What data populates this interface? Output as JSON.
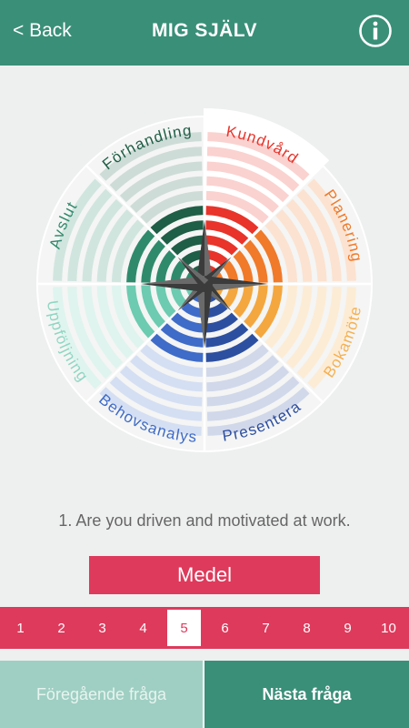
{
  "header": {
    "back_label": "< Back",
    "title": "MIG SJÄLV",
    "info_icon": "info-icon"
  },
  "wheel": {
    "segments": [
      {
        "label": "Kundvård",
        "color": "#e8342a",
        "label_color": "#e8342a",
        "level": 5,
        "highlighted": true
      },
      {
        "label": "Planering",
        "color": "#f07a2a",
        "label_color": "#f07a2a",
        "level": 5,
        "highlighted": false
      },
      {
        "label": "Bokamöte",
        "color": "#f4a73f",
        "label_color": "#f6b050",
        "level": 5,
        "highlighted": false
      },
      {
        "label": "Presentera",
        "color": "#2d4fa0",
        "label_color": "#2d4fa0",
        "level": 5,
        "highlighted": false
      },
      {
        "label": "Behovsanalys",
        "color": "#3f6cc8",
        "label_color": "#3f6cc8",
        "level": 5,
        "highlighted": false
      },
      {
        "label": "Uppföljning",
        "color": "#6ccbb0",
        "label_color": "#8fd6c2",
        "level": 5,
        "highlighted": false
      },
      {
        "label": "Avslut",
        "color": "#2f8a6c",
        "label_color": "#2f8a6c",
        "level": 5,
        "highlighted": false
      },
      {
        "label": "Förhandling",
        "color": "#1f5e47",
        "label_color": "#1f5e47",
        "level": 5,
        "highlighted": false
      }
    ],
    "max_level": 10
  },
  "question": {
    "text": "1. Are you driven and motivated at work."
  },
  "answer": {
    "label": "Medel"
  },
  "scale": {
    "options": [
      "1",
      "2",
      "3",
      "4",
      "5",
      "6",
      "7",
      "8",
      "9",
      "10"
    ],
    "selected": "5"
  },
  "footer": {
    "prev_label": "Föregående fråga",
    "next_label": "Nästa fråga"
  },
  "colors": {
    "header_bg": "#3a8f78",
    "accent": "#de3a5c",
    "prev_bg": "#9fcfc2"
  }
}
